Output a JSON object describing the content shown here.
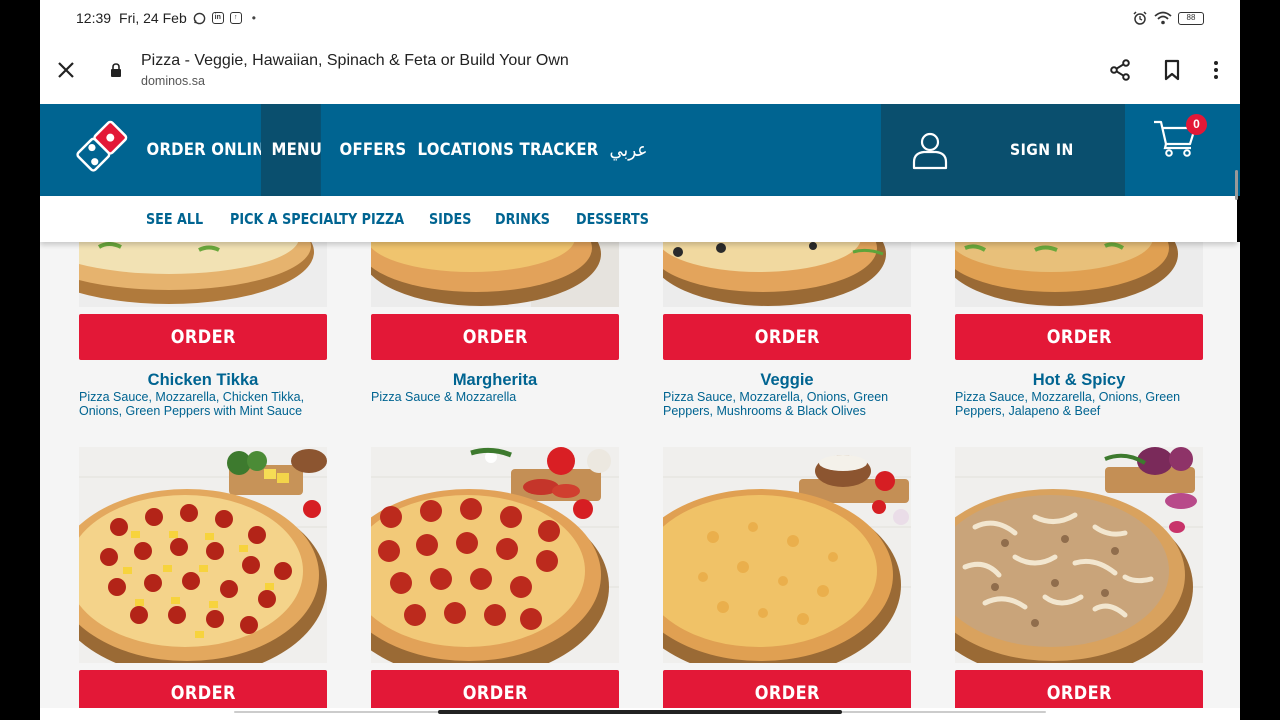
{
  "status_bar": {
    "time": "12:39",
    "date": "Fri, 24 Feb",
    "battery": "88",
    "icons": [
      "whatsapp-icon",
      "linkedin-icon",
      "upload-icon",
      "alarm-icon",
      "wifi-icon"
    ]
  },
  "tab": {
    "title": "Pizza - Veggie, Hawaiian, Spinach & Feta or Build Your Own",
    "url": "dominos.sa"
  },
  "header": {
    "nav": [
      "ORDER ONLINE",
      "MENU",
      "OFFERS",
      "LOCATIONS",
      "TRACKER",
      "عربي"
    ],
    "active_nav": "MENU",
    "sign_in": "SIGN IN",
    "cart_count": "0"
  },
  "subnav": [
    "SEE ALL",
    "PICK A SPECIALTY PIZZA",
    "SIDES",
    "DRINKS",
    "DESSERTS"
  ],
  "order_label": "ORDER",
  "pizzas_row1": [
    {
      "name": "Chicken Tikka",
      "desc": "Pizza Sauce, Mozzarella, Chicken Tikka, Onions, Green Peppers with Mint Sauce"
    },
    {
      "name": "Margherita",
      "desc": "Pizza Sauce & Mozzarella"
    },
    {
      "name": "Veggie",
      "desc": "Pizza Sauce, Mozzarella, Onions, Green Peppers, Mushrooms & Black Olives"
    },
    {
      "name": "Hot & Spicy",
      "desc": "Pizza Sauce, Mozzarella, Onions, Green Peppers, Jalapeno & Beef"
    }
  ],
  "pizzas_row2": [
    {
      "topping": "pepperoni-pineapple"
    },
    {
      "topping": "pepperoni"
    },
    {
      "topping": "cheese"
    },
    {
      "topping": "chicken"
    }
  ],
  "colors": {
    "brand_blue": "#006491",
    "dark_blue": "#0a4f6e",
    "order_red": "#e31837"
  }
}
